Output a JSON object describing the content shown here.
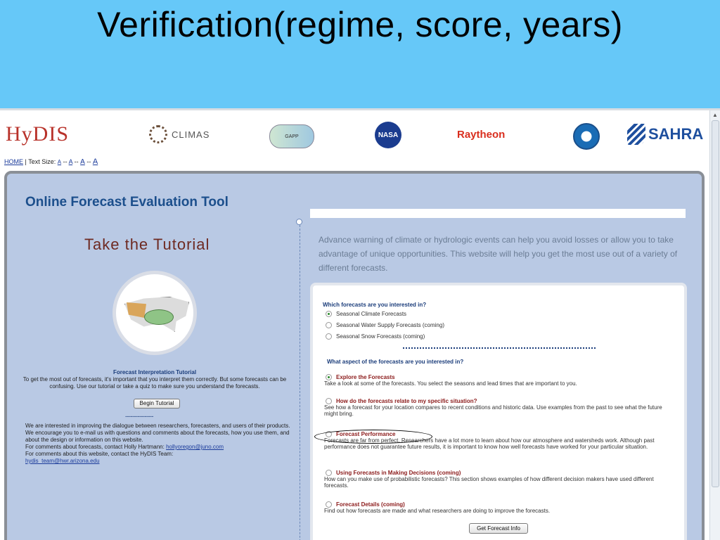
{
  "slide": {
    "title": "Verification(regime, score, years)"
  },
  "logos": {
    "hydis": "HyDIS",
    "climas": "CLIMAS",
    "gapp": "GAPP",
    "nasa": "NASA",
    "raytheon": "Raytheon",
    "noaa": "",
    "sahra": "SAHRA"
  },
  "topnav": {
    "home": "HOME",
    "text_size_label": "Text Size:",
    "size_a1": "A",
    "size_a2": "A",
    "size_a3": "A",
    "size_a4": "A",
    "sep": "--"
  },
  "left": {
    "tool_title": "Online Forecast Evaluation Tool",
    "tutorial_title": "Take the Tutorial",
    "caption_title": "Forecast Interpretation Tutorial",
    "caption_text": "To get the most out of forecasts, it's important that you interpret them correctly. But some forecasts can be confusing. Use our tutorial or take a quiz to make sure you understand the forecasts.",
    "begin_button": "Begin Tutorial",
    "dash_line": "----------------",
    "intro_text": "We are interested in improving the dialogue between researchers, forecasters, and users of their products. We encourage you to e-mail us with questions and comments about the forecasts, how you use them, and about the design or information on this website.",
    "forecast_contact": "For comments about forecasts, contact Holly Hartmann:",
    "forecast_email": "hollyoregon@juno.com",
    "website_contact": "For comments about this website, contact the HyDIS Team:",
    "website_email": "hydis_team@hwr.arizona.edu"
  },
  "right": {
    "advance_text": "Advance warning of climate or hydrologic events can help you avoid losses or allow you to take advantage of unique opportunities. This website will help you get the most use out of a variety of different forecasts.",
    "q1": "Which forecasts are you interested in?",
    "forecast_options": [
      "Seasonal Climate Forecasts",
      "Seasonal Water Supply Forecasts (coming)",
      "Seasonal Snow Forecasts (coming)"
    ],
    "q2": "What aspect of the forecasts are you interested in?",
    "aspects": [
      {
        "title": "Explore the Forecasts",
        "desc": "Take a look at some of the forecasts. You select the seasons and lead times that are important to you."
      },
      {
        "title": "How do the forecasts relate to my specific situation?",
        "desc": "See how a forecast for your location compares to recent conditions and historic data. Use examples from the past to see what the future might bring."
      },
      {
        "title": "Forecast Performance",
        "desc": "Forecasts are far from perfect. Researchers have a lot more to learn about how our atmosphere and watersheds work. Although past performance does not guarantee future results, it is important to know how well forecasts have worked for your particular situation."
      },
      {
        "title": "Using Forecasts in Making Decisions (coming)",
        "desc": "How can you make use of probabilistic forecasts? This section shows examples of how different decision makers have used different forecasts."
      },
      {
        "title": "Forecast Details (coming)",
        "desc": "Find out how forecasts are made and what researchers are doing to improve the forecasts."
      }
    ],
    "get_button": "Get Forecast Info"
  }
}
